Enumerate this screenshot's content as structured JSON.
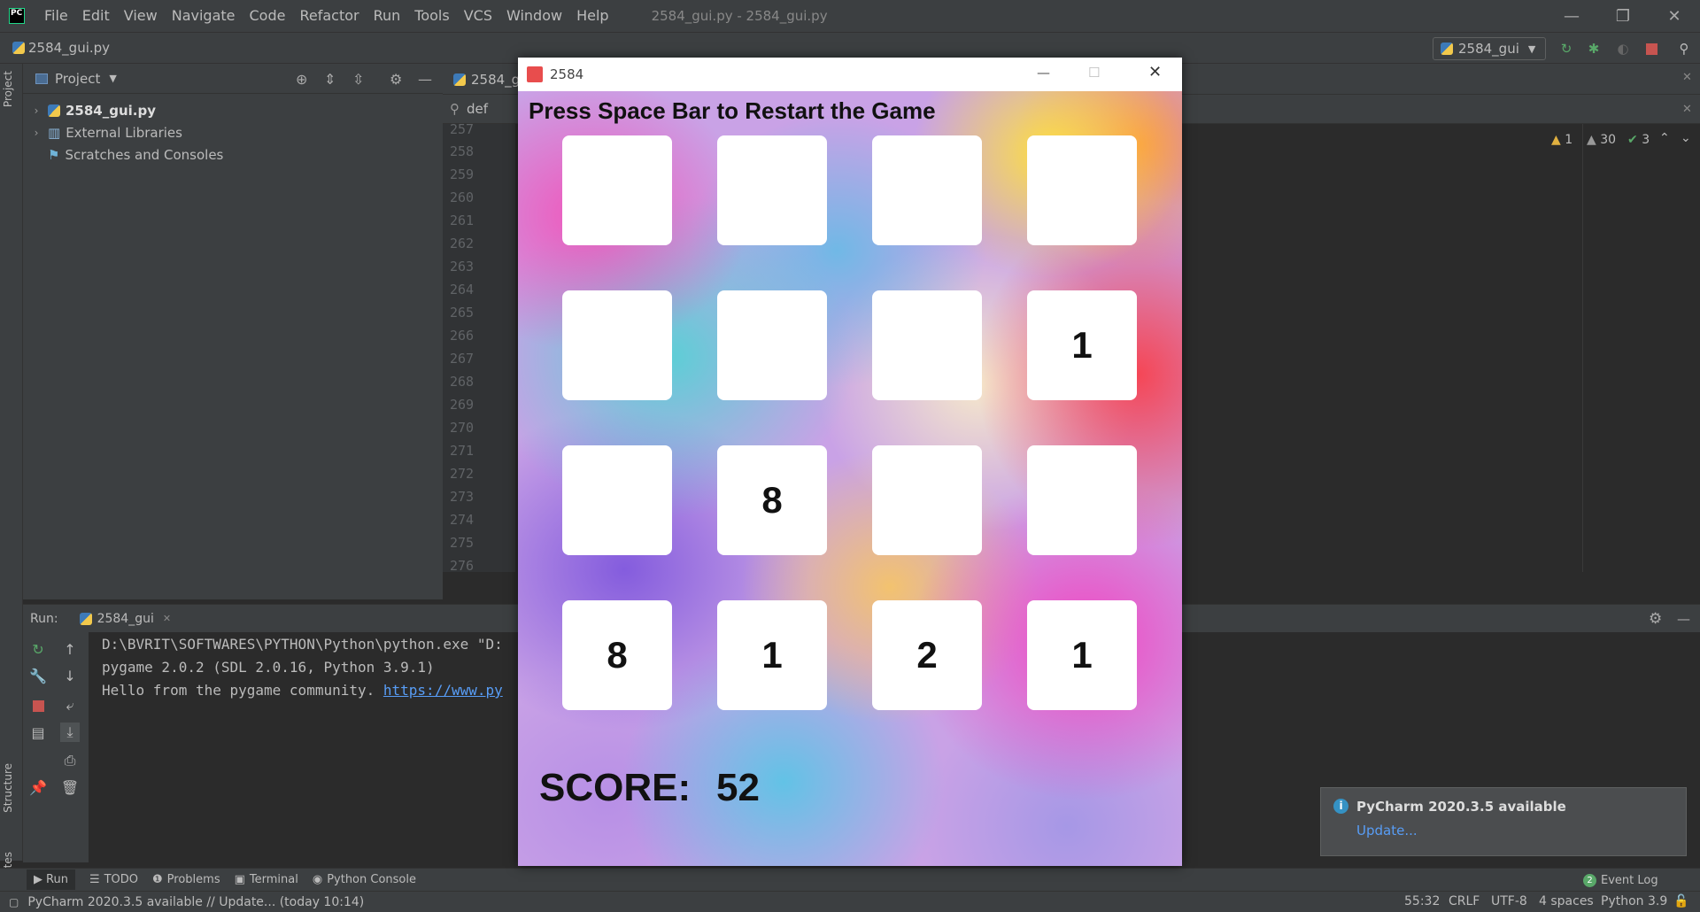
{
  "ide": {
    "menu": [
      "File",
      "Edit",
      "View",
      "Navigate",
      "Code",
      "Refactor",
      "Run",
      "Tools",
      "VCS",
      "Window",
      "Help"
    ],
    "window_title": "2584_gui.py - 2584_gui.py",
    "nav_file": "2584_gui.py",
    "run_config": "2584_gui"
  },
  "project": {
    "header": "Project",
    "tree": [
      "2584_gui.py",
      "External Libraries",
      "Scratches and Consoles"
    ]
  },
  "editor": {
    "tab_label": "2584_g",
    "search_text": "def",
    "line_numbers": [
      "257",
      "258",
      "259",
      "260",
      "261",
      "262",
      "263",
      "264",
      "265",
      "266",
      "267",
      "268",
      "269",
      "270",
      "271",
      "272",
      "273",
      "274",
      "275",
      "276"
    ],
    "inspections": {
      "warn1": "1",
      "warn2": "30",
      "ok": "3"
    }
  },
  "run": {
    "label": "Run:",
    "tab": "2584_gui",
    "console": [
      "D:\\BVRIT\\SOFTWARES\\PYTHON\\Python\\python.exe \"D:",
      "pygame 2.0.2 (SDL 2.0.16, Python 3.9.1)",
      "Hello from the pygame community. "
    ],
    "console_link": "https://www.py"
  },
  "bottom_tabs": [
    "Run",
    "TODO",
    "Problems",
    "Terminal",
    "Python Console"
  ],
  "event_log": {
    "count": "2",
    "label": "Event Log"
  },
  "status": {
    "message": "PyCharm 2020.3.5 available // Update... (today 10:14)",
    "position": "55:32",
    "line_sep": "CRLF",
    "encoding": "UTF-8",
    "indent": "4 spaces",
    "interpreter": "Python 3.9"
  },
  "notification": {
    "title": "PyCharm 2020.3.5 available",
    "link": "Update..."
  },
  "vertical_tabs": {
    "project": "Project",
    "structure": "Structure",
    "favorites": "Favorites"
  },
  "game": {
    "window_title": "2584",
    "headline": "Press Space Bar to Restart the Game",
    "grid": [
      [
        "",
        "",
        "",
        ""
      ],
      [
        "",
        "",
        "",
        "1"
      ],
      [
        "",
        "8",
        "",
        ""
      ],
      [
        "8",
        "1",
        "2",
        "1"
      ]
    ],
    "score_label": "SCORE:",
    "score_value": "52"
  }
}
